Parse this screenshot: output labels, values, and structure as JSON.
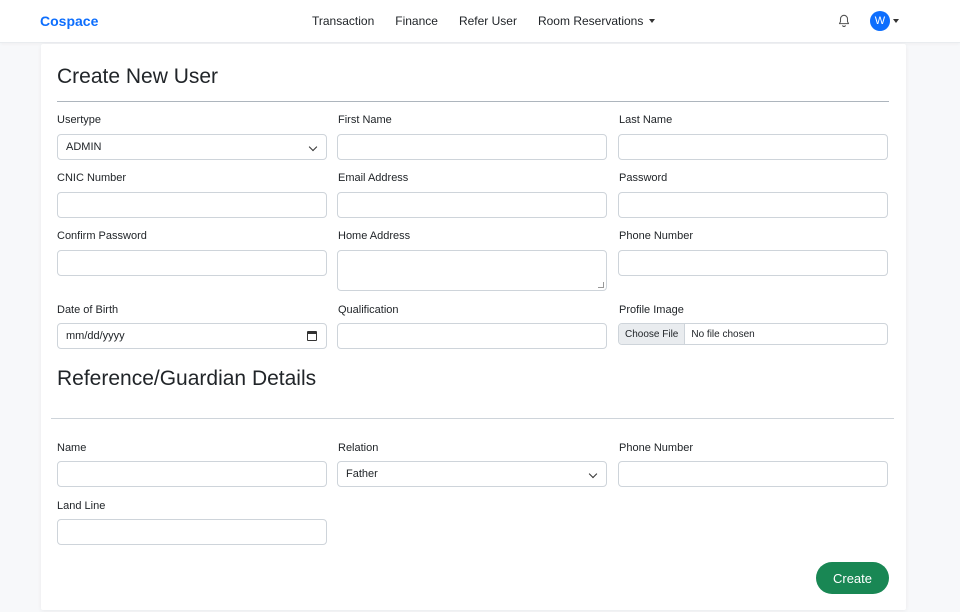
{
  "app": {
    "brand": "Cospace"
  },
  "nav": {
    "items": [
      "Transaction",
      "Finance",
      "Refer User",
      "Room Reservations"
    ],
    "notifications_icon": "bell-icon",
    "avatar_initial": "W"
  },
  "form": {
    "title": "Create New User",
    "fields": {
      "usertype": {
        "label": "Usertype",
        "value": "ADMIN"
      },
      "first_name": {
        "label": "First Name",
        "value": ""
      },
      "last_name": {
        "label": "Last Name",
        "value": ""
      },
      "cnic": {
        "label": "CNIC Number",
        "value": ""
      },
      "email": {
        "label": "Email Address",
        "value": ""
      },
      "password": {
        "label": "Password",
        "value": ""
      },
      "confirm_password": {
        "label": "Confirm Password",
        "value": ""
      },
      "home_address": {
        "label": "Home Address",
        "value": ""
      },
      "phone": {
        "label": "Phone Number",
        "value": ""
      },
      "dob": {
        "label": "Date of Birth",
        "placeholder": "mm/dd/yyyy"
      },
      "qualification": {
        "label": "Qualification",
        "value": ""
      },
      "profile_image": {
        "label": "Profile Image",
        "button": "Choose File",
        "status": "No file chosen"
      }
    },
    "guardian": {
      "title": "Reference/Guardian Details",
      "name": {
        "label": "Name",
        "value": ""
      },
      "relation": {
        "label": "Relation",
        "value": "Father"
      },
      "phone": {
        "label": "Phone Number",
        "value": ""
      },
      "land_line": {
        "label": "Land Line",
        "value": ""
      }
    },
    "submit_label": "Create"
  },
  "colors": {
    "brand": "#0d6efd",
    "submit": "#198754"
  }
}
